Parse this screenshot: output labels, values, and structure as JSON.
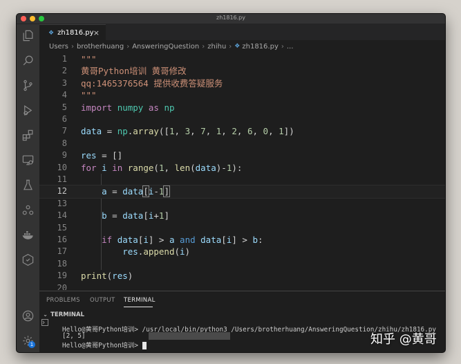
{
  "window": {
    "title": "zh1816.py"
  },
  "tab": {
    "label": "zh1816.py",
    "close": "×"
  },
  "breadcrumbs": [
    "Users",
    "brotherhuang",
    "AnsweringQuestion",
    "zhihu",
    "zh1816.py",
    "..."
  ],
  "editor": {
    "active_line": 12,
    "lines": [
      {
        "n": "1",
        "tokens": [
          {
            "t": "\"\"\"",
            "c": "str"
          }
        ]
      },
      {
        "n": "2",
        "tokens": [
          {
            "t": "黄哥Python培训 黄哥修改",
            "c": "str"
          }
        ]
      },
      {
        "n": "3",
        "tokens": [
          {
            "t": "qq:1465376564 提供收费答疑服务",
            "c": "str"
          }
        ]
      },
      {
        "n": "4",
        "tokens": [
          {
            "t": "\"\"\"",
            "c": "str"
          }
        ]
      },
      {
        "n": "5",
        "tokens": [
          {
            "t": "import",
            "c": "kw"
          },
          {
            "t": " ",
            "c": ""
          },
          {
            "t": "numpy",
            "c": "mod"
          },
          {
            "t": " ",
            "c": ""
          },
          {
            "t": "as",
            "c": "kw"
          },
          {
            "t": " ",
            "c": ""
          },
          {
            "t": "np",
            "c": "mod"
          }
        ]
      },
      {
        "n": "6",
        "tokens": []
      },
      {
        "n": "7",
        "tokens": [
          {
            "t": "data",
            "c": "var"
          },
          {
            "t": " = ",
            "c": ""
          },
          {
            "t": "np",
            "c": "mod"
          },
          {
            "t": ".",
            "c": ""
          },
          {
            "t": "array",
            "c": "fn"
          },
          {
            "t": "([",
            "c": ""
          },
          {
            "t": "1",
            "c": "num"
          },
          {
            "t": ", ",
            "c": ""
          },
          {
            "t": "3",
            "c": "num"
          },
          {
            "t": ", ",
            "c": ""
          },
          {
            "t": "7",
            "c": "num"
          },
          {
            "t": ", ",
            "c": ""
          },
          {
            "t": "1",
            "c": "num"
          },
          {
            "t": ", ",
            "c": ""
          },
          {
            "t": "2",
            "c": "num"
          },
          {
            "t": ", ",
            "c": ""
          },
          {
            "t": "6",
            "c": "num"
          },
          {
            "t": ", ",
            "c": ""
          },
          {
            "t": "0",
            "c": "num"
          },
          {
            "t": ", ",
            "c": ""
          },
          {
            "t": "1",
            "c": "num"
          },
          {
            "t": "])",
            "c": ""
          }
        ]
      },
      {
        "n": "8",
        "tokens": []
      },
      {
        "n": "9",
        "tokens": [
          {
            "t": "res",
            "c": "var"
          },
          {
            "t": " = []",
            "c": ""
          }
        ]
      },
      {
        "n": "10",
        "tokens": [
          {
            "t": "for",
            "c": "kw"
          },
          {
            "t": " ",
            "c": ""
          },
          {
            "t": "i",
            "c": "var"
          },
          {
            "t": " ",
            "c": ""
          },
          {
            "t": "in",
            "c": "kw"
          },
          {
            "t": " ",
            "c": ""
          },
          {
            "t": "range",
            "c": "fn"
          },
          {
            "t": "(",
            "c": ""
          },
          {
            "t": "1",
            "c": "num"
          },
          {
            "t": ", ",
            "c": ""
          },
          {
            "t": "len",
            "c": "fn"
          },
          {
            "t": "(",
            "c": ""
          },
          {
            "t": "data",
            "c": "var"
          },
          {
            "t": ")-",
            "c": ""
          },
          {
            "t": "1",
            "c": "num"
          },
          {
            "t": "):",
            "c": ""
          }
        ]
      },
      {
        "n": "11",
        "tokens": []
      },
      {
        "n": "12",
        "tokens": [
          {
            "t": "    ",
            "c": ""
          },
          {
            "t": "a",
            "c": "var"
          },
          {
            "t": " = ",
            "c": ""
          },
          {
            "t": "data",
            "c": "var"
          },
          {
            "t": "[",
            "c": "box"
          },
          {
            "t": "i",
            "c": "var"
          },
          {
            "t": "-",
            "c": ""
          },
          {
            "t": "1",
            "c": "num"
          },
          {
            "t": "]",
            "c": "box"
          }
        ]
      },
      {
        "n": "13",
        "tokens": []
      },
      {
        "n": "14",
        "tokens": [
          {
            "t": "    ",
            "c": ""
          },
          {
            "t": "b",
            "c": "var"
          },
          {
            "t": " = ",
            "c": ""
          },
          {
            "t": "data",
            "c": "var"
          },
          {
            "t": "[",
            "c": ""
          },
          {
            "t": "i",
            "c": "var"
          },
          {
            "t": "+",
            "c": ""
          },
          {
            "t": "1",
            "c": "num"
          },
          {
            "t": "]",
            "c": ""
          }
        ]
      },
      {
        "n": "15",
        "tokens": []
      },
      {
        "n": "16",
        "tokens": [
          {
            "t": "    ",
            "c": ""
          },
          {
            "t": "if",
            "c": "kw"
          },
          {
            "t": " ",
            "c": ""
          },
          {
            "t": "data",
            "c": "var"
          },
          {
            "t": "[",
            "c": ""
          },
          {
            "t": "i",
            "c": "var"
          },
          {
            "t": "] > ",
            "c": ""
          },
          {
            "t": "a",
            "c": "var"
          },
          {
            "t": " ",
            "c": ""
          },
          {
            "t": "and",
            "c": "bl"
          },
          {
            "t": " ",
            "c": ""
          },
          {
            "t": "data",
            "c": "var"
          },
          {
            "t": "[",
            "c": ""
          },
          {
            "t": "i",
            "c": "var"
          },
          {
            "t": "] > ",
            "c": ""
          },
          {
            "t": "b",
            "c": "var"
          },
          {
            "t": ":",
            "c": ""
          }
        ]
      },
      {
        "n": "17",
        "tokens": [
          {
            "t": "        ",
            "c": ""
          },
          {
            "t": "res",
            "c": "var"
          },
          {
            "t": ".",
            "c": ""
          },
          {
            "t": "append",
            "c": "fn"
          },
          {
            "t": "(",
            "c": ""
          },
          {
            "t": "i",
            "c": "var"
          },
          {
            "t": ")",
            "c": ""
          }
        ]
      },
      {
        "n": "18",
        "tokens": []
      },
      {
        "n": "19",
        "tokens": [
          {
            "t": "print",
            "c": "fn"
          },
          {
            "t": "(",
            "c": ""
          },
          {
            "t": "res",
            "c": "var"
          },
          {
            "t": ")",
            "c": ""
          }
        ]
      },
      {
        "n": "20",
        "tokens": []
      }
    ]
  },
  "panel": {
    "tabs": [
      "PROBLEMS",
      "OUTPUT",
      "TERMINAL"
    ],
    "active_tab": "TERMINAL",
    "terminal_header": "TERMINAL",
    "terminal_lines": [
      "Hello@黄哥Python培训> /usr/local/bin/python3 /Users/brotherhuang/AnsweringQuestion/zhihu/zh1816.py",
      "[2, 5]",
      "Hello@黄哥Python培训> "
    ]
  },
  "activity_bar": {
    "top_icons": [
      "explorer-icon",
      "search-icon",
      "source-control-icon",
      "run-debug-icon",
      "extensions-icon",
      "remote-explorer-icon",
      "testing-icon",
      "live-share-icon",
      "docker-icon",
      "gitlens-icon"
    ],
    "bottom_icons": [
      "account-icon",
      "settings-gear-icon"
    ],
    "settings_badge": "1"
  },
  "watermark": "知乎 @黄哥",
  "colors": {
    "background": "#1e1e1e",
    "activity_bar": "#333333",
    "string": "#ce9178",
    "keyword": "#c586c0",
    "variable": "#9cdcfe",
    "function": "#dcdcaa",
    "number": "#b5cea8",
    "module": "#4ec9b0"
  }
}
